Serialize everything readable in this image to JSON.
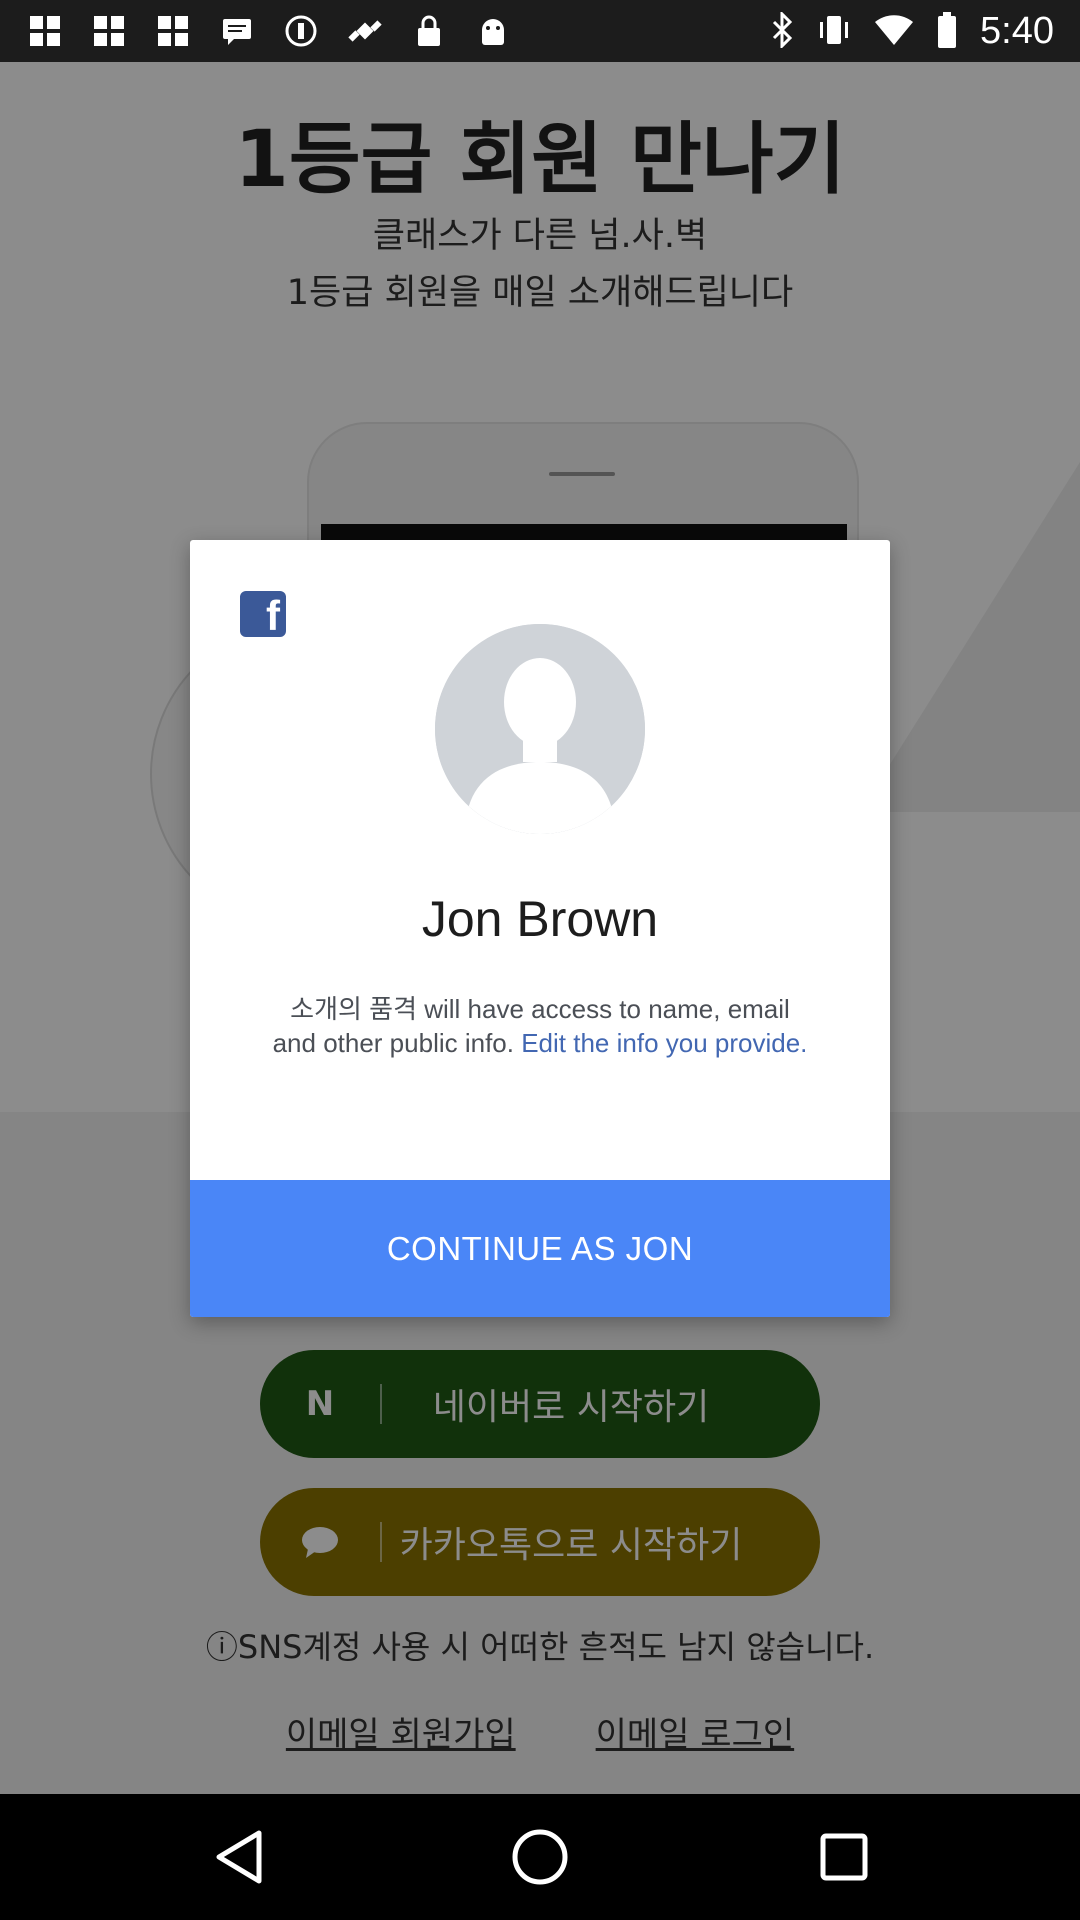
{
  "status_bar": {
    "time": "5:40",
    "left_icons": [
      "grid-icon",
      "grid-icon",
      "grid-icon",
      "message-icon",
      "block-icon",
      "satellite-icon",
      "lock-icon",
      "android-icon"
    ],
    "right_icons": [
      "bluetooth-icon",
      "vibrate-icon",
      "wifi-icon",
      "battery-icon"
    ]
  },
  "background_app": {
    "hero_title": "1등급 회원 만나기",
    "hero_sub_1": "클래스가 다른 넘.사.벽",
    "hero_sub_2": "1등급 회원을 매일 소개해드립니다",
    "naver_button": "네이버로 시작하기",
    "naver_icon_letter": "N",
    "kakao_button": "카카오톡으로 시작하기",
    "notice": "ⓘSNS계정 사용 시 어떠한 흔적도 남지 않습니다.",
    "email_signup": "이메일 회원가입",
    "email_login": "이메일 로그인",
    "colors": {
      "naver": "#1f5a14",
      "kakao": "#8a7400"
    }
  },
  "dialog": {
    "fb_logo": "f",
    "user_name": "Jon Brown",
    "permission_text": "소개의 품격 will have access to name, email and other public info. ",
    "edit_link": "Edit the info you provide.",
    "continue_button": "CONTINUE AS JON",
    "colors": {
      "button": "#4a86f7",
      "link": "#4267b2",
      "fb": "#3b5998"
    }
  },
  "nav_bar": {
    "buttons": [
      "back-icon",
      "home-icon",
      "recents-icon"
    ]
  }
}
